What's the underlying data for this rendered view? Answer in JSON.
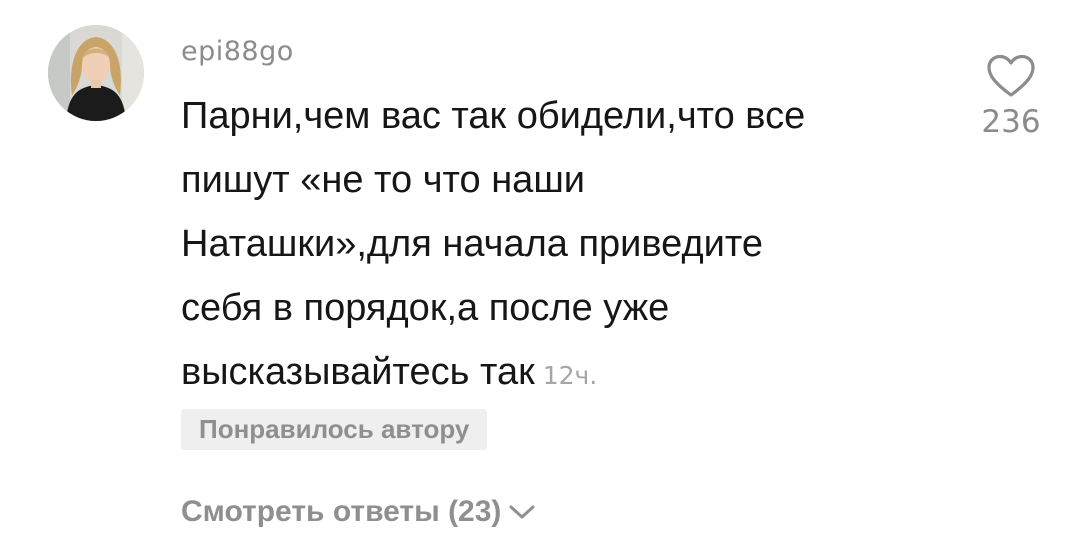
{
  "comment": {
    "username": "epi88go",
    "text_lines": [
      "Парни,чем вас так обидели,что все",
      "пишут «не то что наши",
      "Наташки»,для начала приведите",
      "себя в порядок,а после уже",
      "высказывайтесь так"
    ],
    "timestamp": "12ч.",
    "liked_by_author": "Понравилось автору",
    "view_replies": "Смотреть ответы (23)",
    "likes": "236",
    "icons": {
      "like": "heart-outline-icon",
      "expand": "chevron-down-icon"
    }
  },
  "colors": {
    "text": "#161616",
    "secondary": "#8c8c8c",
    "badge_bg": "#efefef"
  }
}
